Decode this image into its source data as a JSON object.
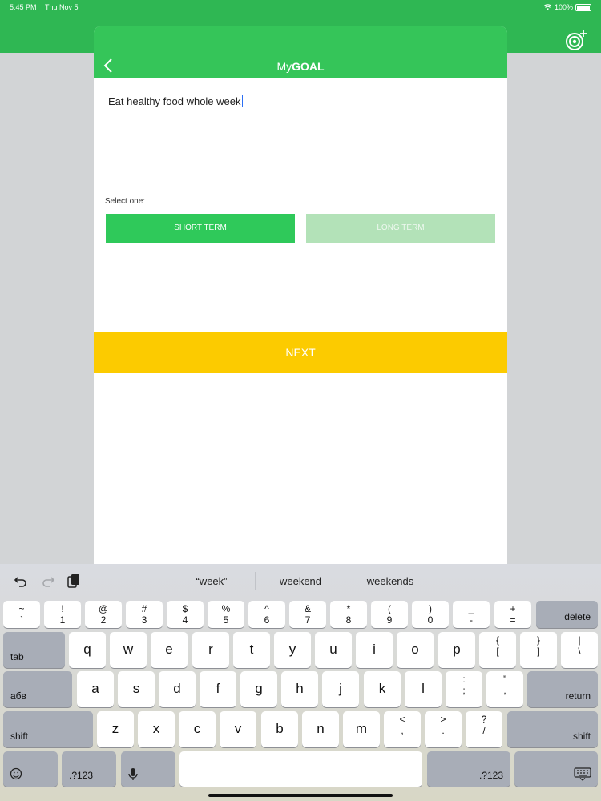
{
  "status_bar": {
    "time": "5:45 PM",
    "date": "Thu Nov 5",
    "battery": "100%"
  },
  "app": {
    "title_prefix": "My",
    "title_bold": "GOAL",
    "header_action_icon": "target-add-icon"
  },
  "goal": {
    "text": "Eat healthy food whole week"
  },
  "term": {
    "prompt": "Select one:",
    "short_label": "SHORT TERM",
    "long_label": "LONG TERM",
    "selected": "SHORT TERM"
  },
  "next_label": "NEXT",
  "colors": {
    "header_green": "#2fb753",
    "sheet_header_green": "#35c559",
    "short_term_green": "#2fc95a",
    "long_term_green": "#b3e2b8",
    "next_yellow": "#fccb00"
  },
  "keyboard": {
    "suggestions": [
      "“week”",
      "weekend",
      "weekends"
    ],
    "shortcut_icons": [
      "undo-icon",
      "redo-icon",
      "paste-icon"
    ],
    "row1": [
      {
        "top": "~",
        "bottom": "`"
      },
      {
        "top": "!",
        "bottom": "1"
      },
      {
        "top": "@",
        "bottom": "2"
      },
      {
        "top": "#",
        "bottom": "3"
      },
      {
        "top": "$",
        "bottom": "4"
      },
      {
        "top": "%",
        "bottom": "5"
      },
      {
        "top": "^",
        "bottom": "6"
      },
      {
        "top": "&",
        "bottom": "7"
      },
      {
        "top": "*",
        "bottom": "8"
      },
      {
        "top": "(",
        "bottom": "9"
      },
      {
        "top": ")",
        "bottom": "0"
      },
      {
        "top": "_",
        "bottom": "-"
      },
      {
        "top": "+",
        "bottom": "="
      }
    ],
    "delete": "delete",
    "tab": "tab",
    "row2": [
      "q",
      "w",
      "e",
      "r",
      "t",
      "y",
      "u",
      "i",
      "o",
      "p"
    ],
    "row2_extra": [
      {
        "top": "{",
        "bottom": "["
      },
      {
        "top": "}",
        "bottom": "]"
      },
      {
        "top": "|",
        "bottom": "\\"
      }
    ],
    "lang": "абв",
    "row3": [
      "a",
      "s",
      "d",
      "f",
      "g",
      "h",
      "j",
      "k",
      "l"
    ],
    "row3_extra": [
      {
        "top": ":",
        "bottom": ";"
      },
      {
        "top": "”",
        "bottom": ","
      }
    ],
    "return": "return",
    "shift": "shift",
    "row4": [
      "z",
      "x",
      "c",
      "v",
      "b",
      "n",
      "m"
    ],
    "row4_extra": [
      {
        "top": "<",
        "bottom": ","
      },
      {
        "top": ">",
        "bottom": "."
      },
      {
        "top": "?",
        "bottom": "/"
      }
    ],
    "numbers_label": ".?123",
    "bottom_icons": [
      "emoji-icon",
      "microphone-icon",
      "keyboard-dismiss-icon"
    ]
  }
}
